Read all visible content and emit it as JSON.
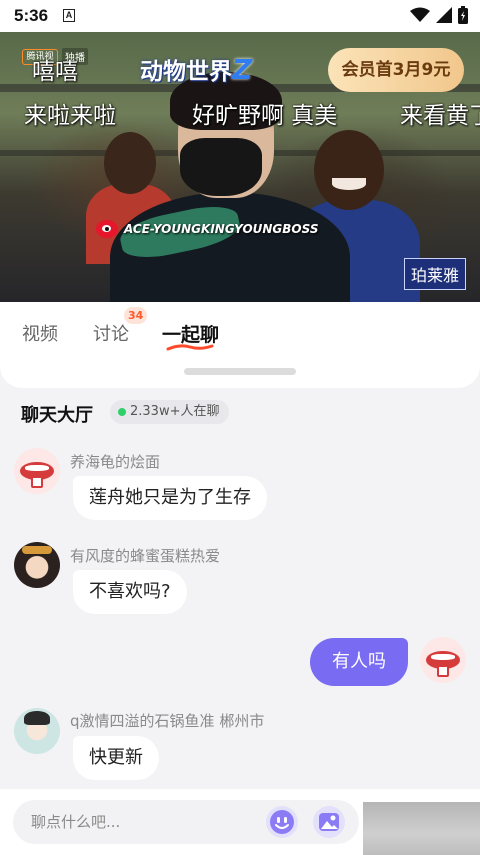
{
  "status_bar": {
    "time": "5:36",
    "icons": [
      "notification-a-icon",
      "wifi-icon",
      "signal-icon",
      "battery-icon"
    ]
  },
  "video": {
    "channel_logo": "腾讯视频",
    "channel_live": "独播",
    "program_logo": "动物世界",
    "program_logo_mark": "Z",
    "vip_badge": "会员首3月9元",
    "danmaku": [
      "嘻嘻",
      "来啦来啦",
      "好旷野啊 真美",
      "来看黄了"
    ],
    "watermark": "ACE-YOUNGKINGYOUNGBOSS",
    "brand_tag": "珀莱雅"
  },
  "tabs": {
    "items": [
      {
        "label": "视频"
      },
      {
        "label": "讨论",
        "badge": "34"
      },
      {
        "label": "一起聊",
        "active": true
      }
    ]
  },
  "chat": {
    "hall_title": "聊天大厅",
    "online_count": "2.33w+人在聊",
    "messages": [
      {
        "user": "养海龟的烩面",
        "text": "莲舟她只是为了生存",
        "mine": false
      },
      {
        "user": "有风度的蜂蜜蛋糕热爱",
        "text": "不喜欢吗?",
        "mine": false
      },
      {
        "user": "",
        "text": "有人吗",
        "mine": true
      },
      {
        "user": "q激情四溢的石锅鱼准",
        "location": "郴州市",
        "text": "快更新",
        "mine": false
      }
    ]
  },
  "input": {
    "placeholder": "聊点什么吧..."
  },
  "colors": {
    "accent": "#7a6cf2",
    "vip_gold": "#f1c78c",
    "badge_orange": "#ff5a2b",
    "online_green": "#2fd06a"
  }
}
